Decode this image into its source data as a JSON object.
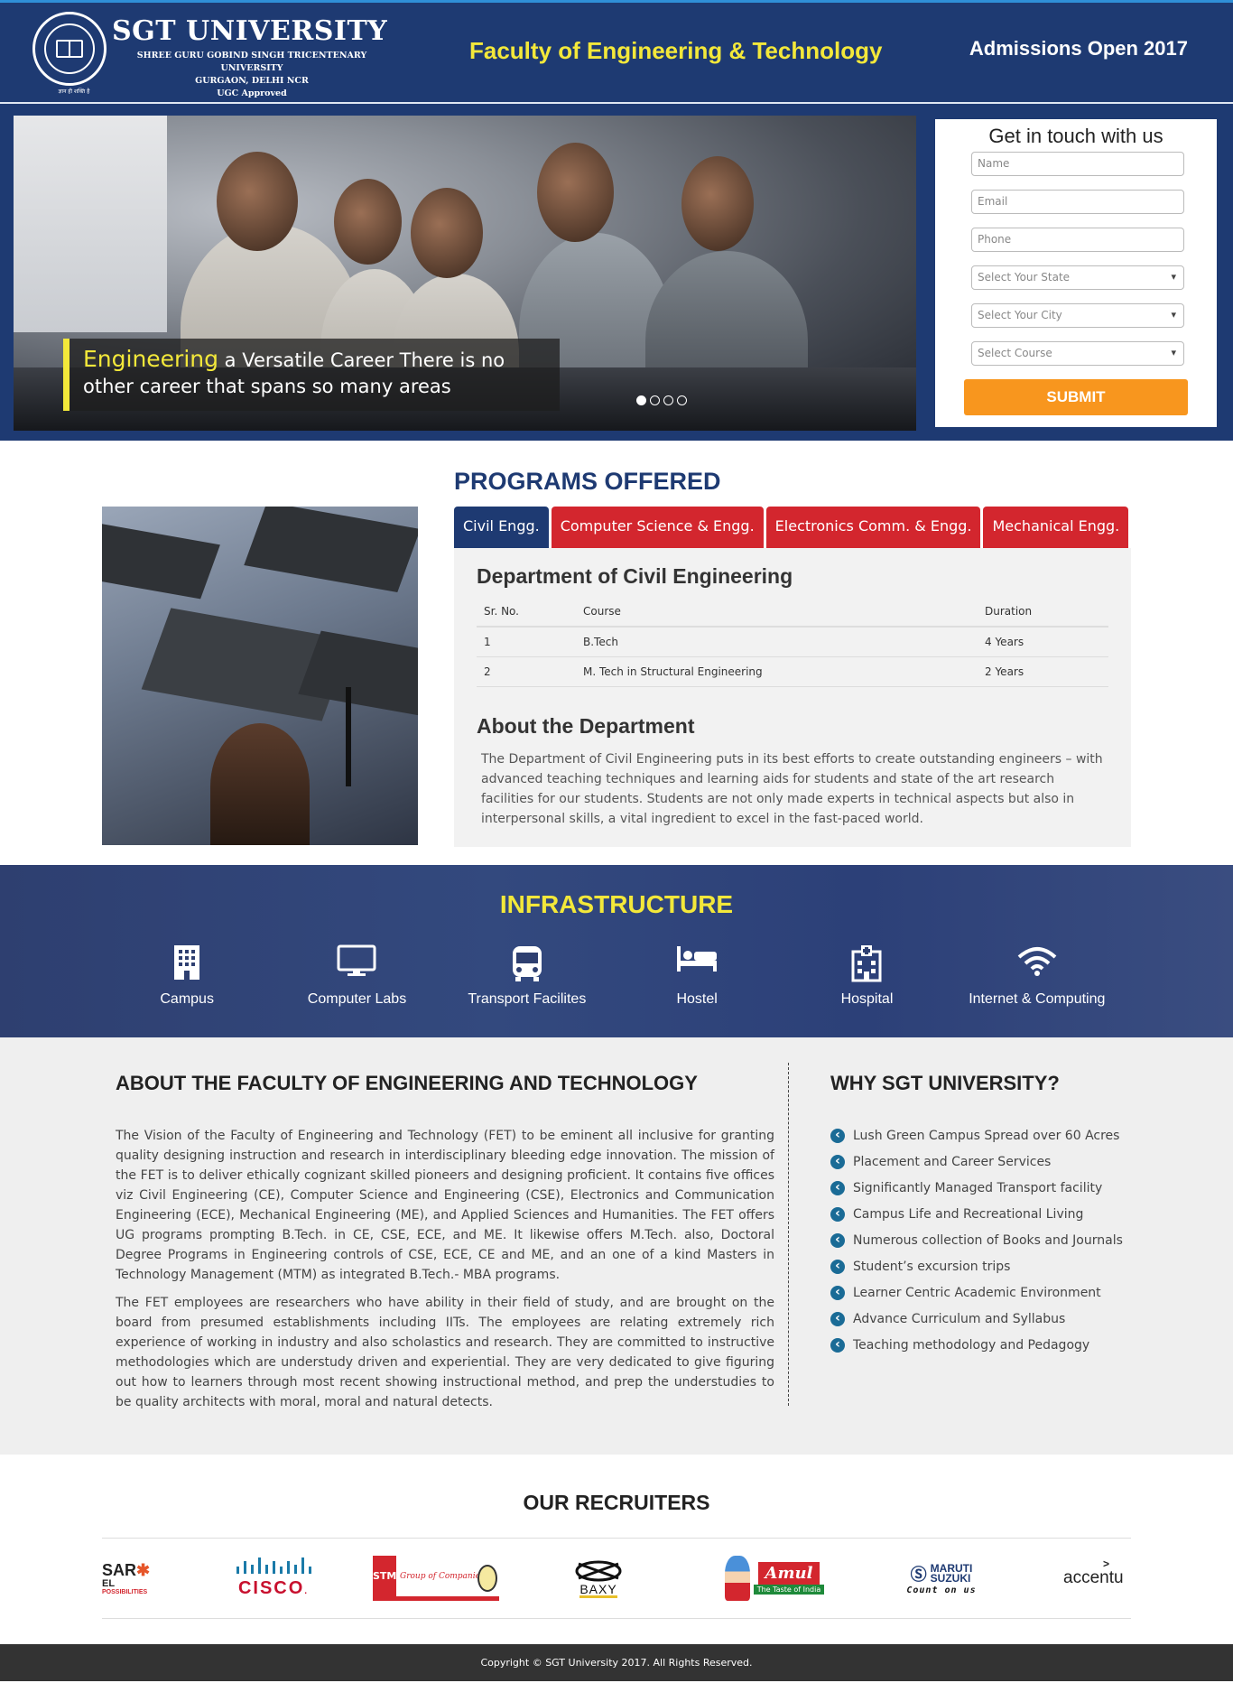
{
  "header": {
    "university_name": "SGT UNIVERSITY",
    "sub_line1": "SHREE GURU GOBIND SINGH TRICENTENARY UNIVERSITY",
    "sub_line2": "GURGAON, DELHI NCR",
    "sub_line3": "UGC Approved",
    "faculty_title": "Faculty of Engineering & Technology",
    "admissions": "Admissions Open 2017"
  },
  "hero": {
    "caption_highlight": "Engineering",
    "caption_rest": " a Versatile Career There is no other career that spans so many areas",
    "slide_count": 4,
    "active_slide": 1
  },
  "contact": {
    "title": "Get in touch with us",
    "name_placeholder": "Name",
    "email_placeholder": "Email",
    "phone_placeholder": "Phone",
    "state_select": "Select Your State",
    "city_select": "Select Your City",
    "course_select": "Select Course",
    "submit_label": "SUBMIT"
  },
  "programs": {
    "title": "PROGRAMS OFFERED",
    "tabs": [
      "Civil Engg.",
      "Computer Science & Engg.",
      "Electronics Comm. & Engg.",
      "Mechanical Engg."
    ],
    "active_tab": 0,
    "department_title": "Department of Civil Engineering",
    "table_headers": [
      "Sr. No.",
      "Course",
      "Duration"
    ],
    "rows": [
      [
        "1",
        "B.Tech",
        "4 Years"
      ],
      [
        "2",
        "M. Tech in Structural Engineering",
        "2 Years"
      ]
    ],
    "about_title": "About the Department",
    "about_text": "The Department of Civil Engineering puts in its best efforts to create outstanding engineers – with advanced teaching techniques and learning aids for students and state of the art research facilities for our students. Students are not only made experts in technical aspects but also in interpersonal skills, a vital ingredient to excel in the fast-paced world."
  },
  "infrastructure": {
    "title": "INFRASTRUCTURE",
    "items": [
      {
        "label": "Campus",
        "icon": "building-icon"
      },
      {
        "label": "Computer Labs",
        "icon": "monitor-icon"
      },
      {
        "label": "Transport Facilites",
        "icon": "bus-icon"
      },
      {
        "label": "Hostel",
        "icon": "bed-icon"
      },
      {
        "label": "Hospital",
        "icon": "hospital-icon"
      },
      {
        "label": "Internet & Computing",
        "icon": "wifi-icon"
      }
    ]
  },
  "about": {
    "title": "ABOUT THE FACULTY OF ENGINEERING AND TECHNOLOGY",
    "para1": "The Vision of the Faculty of Engineering and Technology (FET) to be eminent all inclusive for granting quality designing instruction and research in interdisciplinary bleeding edge innovation. The mission of the FET is to deliver ethically cognizant skilled pioneers and designing proficient. It contains five offices viz Civil Engineering (CE), Computer Science and Engineering (CSE), Electronics and Communication Engineering (ECE), Mechanical Engineering (ME), and Applied Sciences and Humanities. The FET offers UG programs prompting B.Tech. in CE, CSE, ECE, and ME. It likewise offers M.Tech. also, Doctoral Degree Programs in Engineering controls of CSE, ECE, CE and ME, and an one of a kind Masters in Technology Management (MTM) as integrated B.Tech.- MBA programs.",
    "para2": "The FET employees are researchers who have ability in their field of study, and are brought on the board from presumed establishments including IITs. The employees are relating extremely rich experience of working in industry and also scholastics and research. They are committed to instructive methodologies which are understudy driven and experiential. They are very dedicated to give figuring out how to learners through most recent showing instructional method, and prep the understudies to be quality architects with moral, moral and natural detects."
  },
  "why": {
    "title": "WHY SGT UNIVERSITY?",
    "items": [
      "Lush Green Campus Spread over 60 Acres",
      "Placement and Career Services",
      "Significantly Managed Transport facility",
      "Campus Life and Recreational Living",
      "Numerous collection of Books and Journals",
      "Student’s excursion trips",
      "Learner Centric Academic Environment",
      "Advance Curriculum and Syllabus",
      "Teaching methodology and Pedagogy"
    ]
  },
  "recruiters": {
    "title": "OUR RECRUITERS",
    "logos": [
      {
        "name": "essar",
        "text1": "SAR",
        "text2": "EL",
        "text3": "POSSIBILITIES"
      },
      {
        "name": "cisco",
        "text1": "CISCO",
        "text2": ".",
        "text3": ""
      },
      {
        "name": "stm",
        "text1": "STM",
        "text2": "Group of Companies",
        "text3": ""
      },
      {
        "name": "baxy",
        "text1": "BAXY",
        "text2": "",
        "text3": ""
      },
      {
        "name": "amul",
        "text1": "Amul",
        "text2": "The Taste of India",
        "text3": ""
      },
      {
        "name": "maruti-suzuki",
        "text1": "MARUTI",
        "text2": "SUZUKI",
        "text3": "Count on us"
      },
      {
        "name": "accenture",
        "text1": "accentu",
        "text2": ">",
        "text3": ""
      }
    ]
  },
  "footer": {
    "copyright": "Copyright © SGT University 2017. All Rights Reserved."
  }
}
